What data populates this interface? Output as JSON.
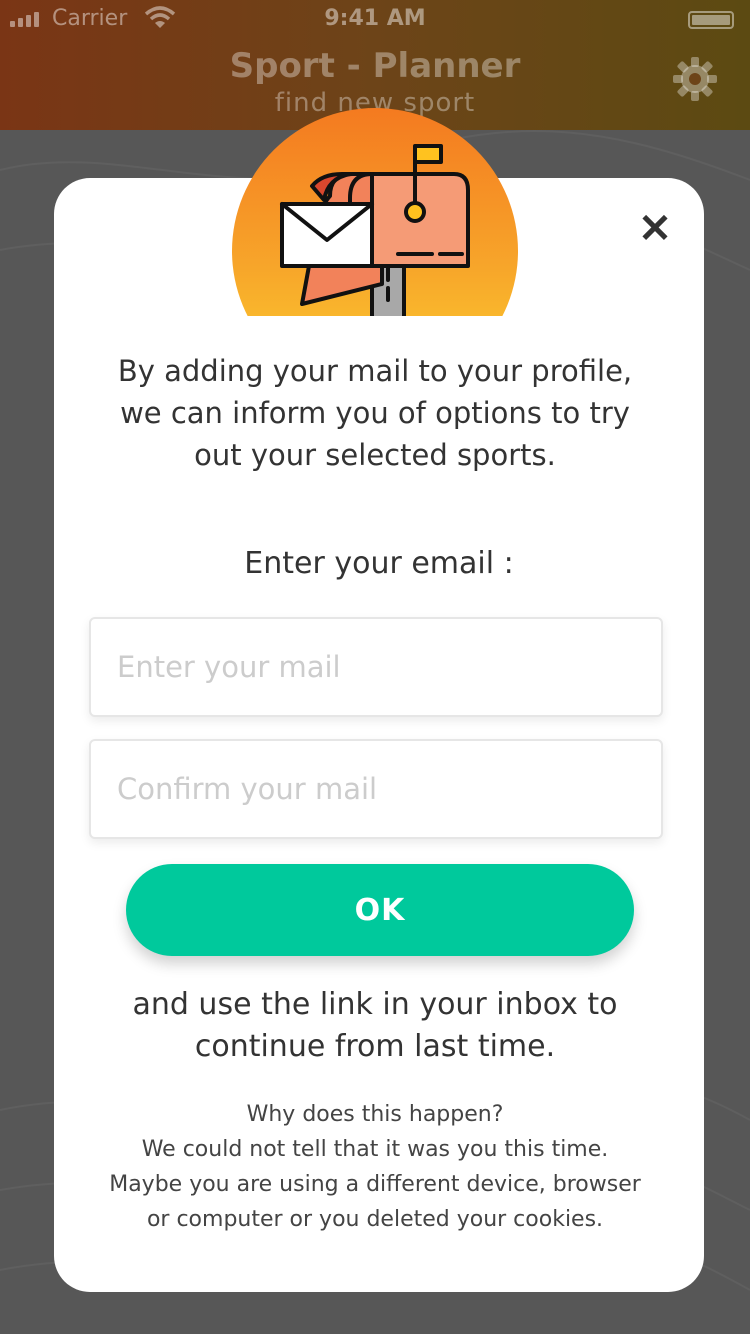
{
  "status_bar": {
    "carrier": "Carrier",
    "time": "9:41 AM"
  },
  "header": {
    "title": "Sport - Planner",
    "subtitle": "find new sport",
    "settings_icon": "gear-icon"
  },
  "modal": {
    "illustration_icon": "mailbox-icon",
    "close_label": "✕",
    "intro_text": "By adding your mail to your profile, we can inform you of options to try out your selected sports.",
    "enter_label": "Enter your email :",
    "email_field": {
      "value": "",
      "placeholder": "Enter your mail"
    },
    "confirm_field": {
      "value": "",
      "placeholder": "Confirm your mail"
    },
    "ok_label": "OK",
    "continue_text": "and use the link in your inbox to continue from last time.",
    "why_title": "Why does this happen?",
    "why_line1": "We could not tell that it was you this time.",
    "why_line2": "Maybe  you are using a different device, browser",
    "why_line3": "or computer or you deleted your cookies."
  },
  "colors": {
    "accent": "#00c99c",
    "hero_top": "#f47a20",
    "hero_bottom": "#fdd02f",
    "text": "#333333"
  }
}
